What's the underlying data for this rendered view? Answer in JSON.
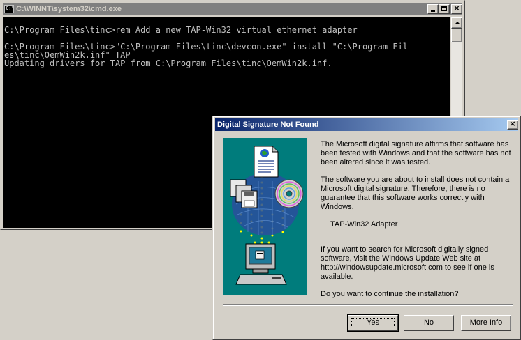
{
  "cmd_window": {
    "title": "C:\\WINNT\\system32\\cmd.exe",
    "console_lines": [
      "C:\\Program Files\\tinc>rem Add a new TAP-Win32 virtual ethernet adapter",
      "",
      "C:\\Program Files\\tinc>\"C:\\Program Files\\tinc\\devcon.exe\" install \"C:\\Program Fil",
      "es\\tinc\\OemWin2k.inf\" TAP",
      "Updating drivers for TAP from C:\\Program Files\\tinc\\OemWin2k.inf."
    ]
  },
  "dialog": {
    "title": "Digital Signature Not Found",
    "paragraph1": "The Microsoft digital signature affirms that software has been tested with Windows and that the software has not been altered since it was tested.",
    "paragraph2": "The software you are about to install does not contain a Microsoft digital signature. Therefore,  there is no guarantee that this software works correctly with Windows.",
    "device_name": "TAP-Win32 Adapter",
    "paragraph3": "If you want to search for Microsoft digitally signed software, visit the Windows Update Web site at http://windowsupdate.microsoft.com to see if one is available.",
    "question": "Do you want to continue the installation?",
    "buttons": {
      "yes": "Yes",
      "no": "No",
      "more_info": "More Info"
    }
  },
  "colors": {
    "console_bg": "#000000",
    "console_fg": "#c0c0c0",
    "active_title_start": "#0a246a",
    "active_title_end": "#a6caf0",
    "inactive_title": "#808080",
    "illustration_bg": "#007c7c"
  }
}
